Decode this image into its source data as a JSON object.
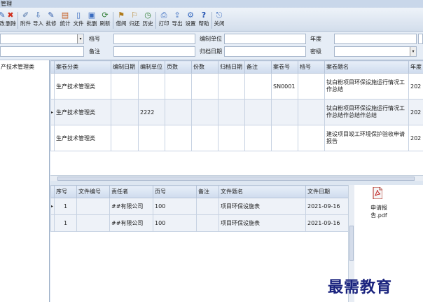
{
  "window": {
    "title": "管理"
  },
  "toolbar": {
    "buttons": [
      {
        "label": "改",
        "icon": "edit-icon"
      },
      {
        "label": "删除",
        "icon": "delete-icon"
      },
      {
        "label": "附件",
        "icon": "attachment-icon"
      },
      {
        "label": "导入",
        "icon": "import-icon"
      },
      {
        "label": "批修",
        "icon": "batch-edit-icon"
      },
      {
        "label": "统计",
        "icon": "statistics-icon"
      },
      {
        "label": "文件",
        "icon": "file-icon"
      },
      {
        "label": "批删",
        "icon": "batch-delete-icon"
      },
      {
        "label": "刷新",
        "icon": "refresh-icon"
      },
      {
        "label": "借阅",
        "icon": "borrow-icon"
      },
      {
        "label": "归还",
        "icon": "return-icon"
      },
      {
        "label": "历史",
        "icon": "history-icon"
      },
      {
        "label": "打印",
        "icon": "print-icon"
      },
      {
        "label": "导出",
        "icon": "export-icon"
      },
      {
        "label": "设置",
        "icon": "settings-icon"
      },
      {
        "label": "帮助",
        "icon": "help-icon"
      },
      {
        "label": "关闭",
        "icon": "close-icon"
      }
    ]
  },
  "form": {
    "label_dangh": "档号",
    "label_bianzhidanwei": "编制单位",
    "label_niandu": "年度",
    "label_beizhu": "备注",
    "label_guidangriqi": "归档日期",
    "label_miji": "密级"
  },
  "tree": {
    "items": [
      "产技术管理类"
    ]
  },
  "upper_table": {
    "headers": [
      "案卷分类",
      "编制日期",
      "编制单位",
      "页数",
      "份数",
      "归档日期",
      "备注",
      "案卷号",
      "档号",
      "案卷题名",
      "年度"
    ],
    "rows": [
      [
        "生产技术管理类",
        "",
        "",
        "",
        "",
        "",
        "",
        "SN0001",
        "",
        "钛白粉项目环保设施运行情况工作总结",
        "202"
      ],
      [
        "生产技术管理类",
        "",
        "2222",
        "",
        "",
        "",
        "",
        "",
        "",
        "钛白粉项目环保设施运行情况工作总结作总结作总结",
        "202"
      ],
      [
        "生产技术管理类",
        "",
        "",
        "",
        "",
        "",
        "",
        "",
        "",
        "建设项目竣工环境保护验收申请报告",
        "202"
      ]
    ]
  },
  "lower_table": {
    "headers": [
      "序号",
      "文件编号",
      "责任者",
      "页号",
      "备注",
      "文件题名",
      "文件日期"
    ],
    "rows": [
      [
        "1",
        "",
        "##有限公司",
        "100",
        "",
        "项目环保设施表",
        "2021-09-16"
      ],
      [
        "1",
        "",
        "##有限公司",
        "100",
        "",
        "项目环保设施表",
        "2021-09-16"
      ]
    ]
  },
  "file_panel": {
    "file_name": "申请报告.pdf",
    "icon": "pdf-file-icon"
  },
  "watermark": {
    "text": "最需教育"
  }
}
